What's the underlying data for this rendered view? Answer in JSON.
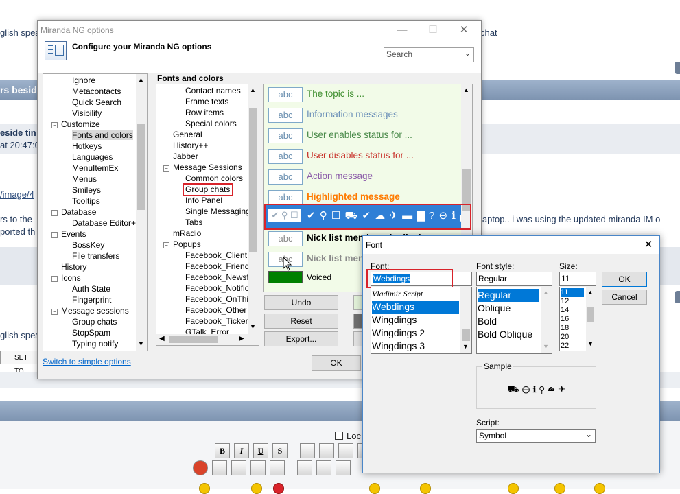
{
  "background": {
    "row1_left": "glish spea",
    "row1_right": "chat",
    "band1_text": "rs besid",
    "gray_line1": "eside tin",
    "gray_line2": "at 20:47:0",
    "image_link": "/image/4",
    "body_line1": "rs to the",
    "body_line1_right": "laptop.. i was using the updated miranda IM o",
    "body_line2": "ported th",
    "row2_left": "glish spea",
    "set_button": "SET TO",
    "lock_label": "Loc",
    "toolbar": [
      "B",
      "I",
      "U",
      "S"
    ]
  },
  "window": {
    "title": "Miranda NG options",
    "header": "Configure your Miranda NG options",
    "search_placeholder": "Search",
    "left_tree": [
      {
        "label": "Ignore",
        "level": 2
      },
      {
        "label": "Metacontacts",
        "level": 2
      },
      {
        "label": "Quick Search",
        "level": 2
      },
      {
        "label": "Visibility",
        "level": 2
      },
      {
        "label": "Customize",
        "level": 1,
        "expander": "−"
      },
      {
        "label": "Fonts and colors",
        "level": 2,
        "selected": true
      },
      {
        "label": "Hotkeys",
        "level": 2
      },
      {
        "label": "Languages",
        "level": 2
      },
      {
        "label": "MenuItemEx",
        "level": 2
      },
      {
        "label": "Menus",
        "level": 2
      },
      {
        "label": "Smileys",
        "level": 2
      },
      {
        "label": "Tooltips",
        "level": 2
      },
      {
        "label": "Database",
        "level": 1,
        "expander": "−"
      },
      {
        "label": "Database Editor++",
        "level": 2
      },
      {
        "label": "Events",
        "level": 1,
        "expander": "−"
      },
      {
        "label": "BossKey",
        "level": 2
      },
      {
        "label": "File transfers",
        "level": 2
      },
      {
        "label": "History",
        "level": 1
      },
      {
        "label": "Icons",
        "level": 1,
        "expander": "−"
      },
      {
        "label": "Auth State",
        "level": 2
      },
      {
        "label": "Fingerprint",
        "level": 2
      },
      {
        "label": "Message sessions",
        "level": 1,
        "expander": "−"
      },
      {
        "label": "Group chats",
        "level": 2
      },
      {
        "label": "StopSpam",
        "level": 2
      },
      {
        "label": "Typing notify",
        "level": 2
      }
    ],
    "section_title": "Fonts and colors",
    "mid_tree": [
      {
        "label": "Contact names",
        "level": 2
      },
      {
        "label": "Frame texts",
        "level": 2
      },
      {
        "label": "Row items",
        "level": 2
      },
      {
        "label": "Special colors",
        "level": 2
      },
      {
        "label": "General",
        "level": 1
      },
      {
        "label": "History++",
        "level": 1
      },
      {
        "label": "Jabber",
        "level": 1
      },
      {
        "label": "Message Sessions",
        "level": 1,
        "expander": "−"
      },
      {
        "label": "Common colors",
        "level": 2
      },
      {
        "label": "Group chats",
        "level": 2,
        "highlight": true
      },
      {
        "label": "Info Panel",
        "level": 2
      },
      {
        "label": "Single Messaging",
        "level": 2
      },
      {
        "label": "Tabs",
        "level": 2
      },
      {
        "label": "mRadio",
        "level": 1
      },
      {
        "label": "Popups",
        "level": 1,
        "expander": "−"
      },
      {
        "label": "Facebook_Client",
        "level": 2
      },
      {
        "label": "Facebook_Friendsh",
        "level": 2
      },
      {
        "label": "Facebook_Newsfee",
        "level": 2
      },
      {
        "label": "Facebook_Notificat",
        "level": 2
      },
      {
        "label": "Facebook_OnThisD",
        "level": 2
      },
      {
        "label": "Facebook_Other",
        "level": 2
      },
      {
        "label": "Facebook_Ticker",
        "level": 2
      },
      {
        "label": "GTalk_Error",
        "level": 2
      }
    ],
    "font_items": [
      {
        "abc": "abc",
        "label": "The topic is ...",
        "color": "#3f8f2f",
        "bold": false
      },
      {
        "abc": "abc",
        "label": "Information messages",
        "color": "#6b8fb8",
        "bold": false
      },
      {
        "abc": "abc",
        "label": "User enables status for ...",
        "color": "#4a8a4a",
        "bold": false
      },
      {
        "abc": "abc",
        "label": "User disables status for ...",
        "color": "#c8312a",
        "bold": false
      },
      {
        "abc": "abc",
        "label": "Action message",
        "color": "#8a5aa8",
        "bold": false
      },
      {
        "abc": "abc",
        "label": "Highlighted message",
        "color": "#ff7a00",
        "bold": true
      }
    ],
    "webdings_preview": "✔ ⚲ ☐ ⛟ ✔ ☁ ✈ ▬ ▇ ? ⊖ ℹ ▞ ▚",
    "nick_items": [
      {
        "abc": "abc",
        "label": "Nick list members (online)",
        "color": "#000000",
        "bold": true
      },
      {
        "abc": "abc",
        "label": "Nick list members (away)",
        "color": "#8a8a8a",
        "bold": true
      }
    ],
    "voiced_label": "Voiced",
    "voiced_color": "#008000",
    "buttons": {
      "undo": "Undo",
      "reset": "Reset",
      "export": "Export...",
      "ok": "OK"
    },
    "switch_link": "Switch to simple options"
  },
  "font_dialog": {
    "title": "Font",
    "font_label": "Font:",
    "font_value": "Webdings",
    "style_label": "Font style:",
    "style_value": "Regular",
    "size_label": "Size:",
    "size_value": "11",
    "fonts": [
      "Vladimir Script",
      "Webdings",
      "Wingdings",
      "Wingdings 2",
      "Wingdings 3"
    ],
    "selected_font": "Webdings",
    "styles": [
      "Regular",
      "Oblique",
      "Bold",
      "Bold Oblique"
    ],
    "selected_style": "Regular",
    "sizes": [
      "11",
      "12",
      "14",
      "16",
      "18",
      "20",
      "22"
    ],
    "selected_size": "11",
    "ok": "OK",
    "cancel": "Cancel",
    "sample_label": "Sample",
    "sample_text": "⛟ ⊖ ℹ ⚲ ☁ ✈",
    "script_label": "Script:",
    "script_value": "Symbol"
  },
  "colors": {
    "selection": "#0078d7",
    "highlight_red": "#d8232a",
    "green_panel": "#f2fbe8"
  }
}
